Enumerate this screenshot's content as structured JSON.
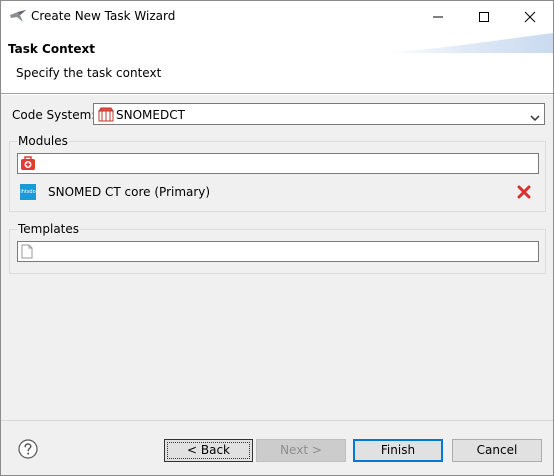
{
  "window": {
    "title": "Create New Task Wizard"
  },
  "banner": {
    "title": "Task Context",
    "subtitle": "Specify the task context"
  },
  "code_system": {
    "label": "Code System:",
    "value": "SNOMEDCT"
  },
  "modules": {
    "group_label": "Modules",
    "search_value": "",
    "items": [
      {
        "label": "SNOMED CT core (Primary)",
        "logo_text": "ihtsdo"
      }
    ]
  },
  "templates": {
    "group_label": "Templates",
    "search_value": ""
  },
  "buttons": {
    "back_label": "< Back",
    "next_label": "Next >",
    "finish_label": "Finish",
    "cancel_label": "Cancel"
  },
  "colors": {
    "accent": "#0078d7",
    "remove": "#d9302c",
    "module_logo": "#1a9ad6"
  }
}
